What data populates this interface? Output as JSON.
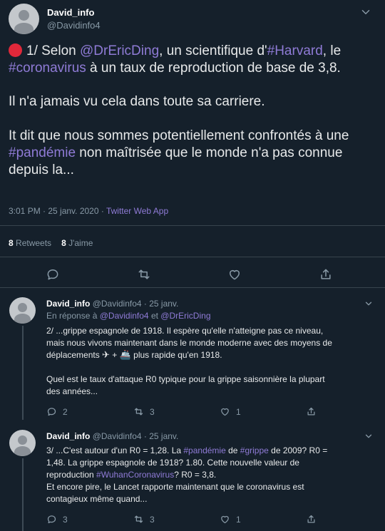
{
  "main": {
    "name": "David_info",
    "handle": "@Davidinfo4",
    "text": {
      "p1_pre": "1/ Selon ",
      "p1_mention": "@DrEricDing",
      "p1_mid": ", un scientifique d'",
      "p1_tag1": "#Harvard",
      "p1_mid2": ", le ",
      "p1_tag2": "#coronavirus",
      "p1_end": " à un taux de reproduction de base de 3,8.",
      "p2": "Il n'a jamais vu cela dans toute sa carriere.",
      "p3_pre": "It dit que nous sommes potentiellement confrontés à une ",
      "p3_tag": "#pandémie",
      "p3_end": " non maîtrisée que le monde n'a pas connue depuis la..."
    },
    "timestamp": "3:01 PM · 25 janv. 2020 · ",
    "source": "Twitter Web App",
    "retweets_count": "8",
    "retweets_label": "Retweets",
    "likes_count": "8",
    "likes_label": "J'aime",
    "accent_dot_color": "#e0283a"
  },
  "replies": [
    {
      "name": "David_info",
      "handle_time": "@Davidinfo4 · 25 janv.",
      "reply_prefix": "En réponse à ",
      "reply_to_1": "@Davidinfo4",
      "reply_and": " et ",
      "reply_to_2": "@DrEricDing",
      "lines": {
        "l1": "2/ ...grippe espagnole de 1918. Il espère qu'elle n'atteigne pas ce niveau,",
        "l2": "mais nous vivons maintenant dans le monde moderne avec des moyens de",
        "l3_pre": "déplacements ",
        "l3_e1": "✈",
        "l3_mid": " + ",
        "l3_e2": "🚢",
        "l3_end": " plus rapide qu'en 1918.",
        "l4": "Quel est le taux d'attaque R0 typique pour la grippe saisonnière la plupart",
        "l5": "des années..."
      },
      "replies_count": "2",
      "retweets_count": "3",
      "likes_count": "1"
    },
    {
      "name": "David_info",
      "handle_time": "@Davidinfo4 · 25 janv.",
      "lines": {
        "l1_pre": "3/ ...C'est autour d'un R0 = 1,28. La ",
        "l1_tag1": "#pandémie",
        "l1_mid": " de ",
        "l1_tag2": "#grippe",
        "l1_end": " de 2009? R0 =",
        "l2": "1,48. La grippe espagnole de 1918? 1.80. Cette nouvelle valeur de",
        "l3_pre": "reproduction ",
        "l3_tag": "#WuhanCoronavirus",
        "l3_end": "? R0 = 3,8.",
        "l4": "Et encore pire, le Lancet rapporte maintenant que le coronavirus est",
        "l5": "contagieux même quand..."
      },
      "replies_count": "3",
      "retweets_count": "3",
      "likes_count": "1"
    }
  ]
}
